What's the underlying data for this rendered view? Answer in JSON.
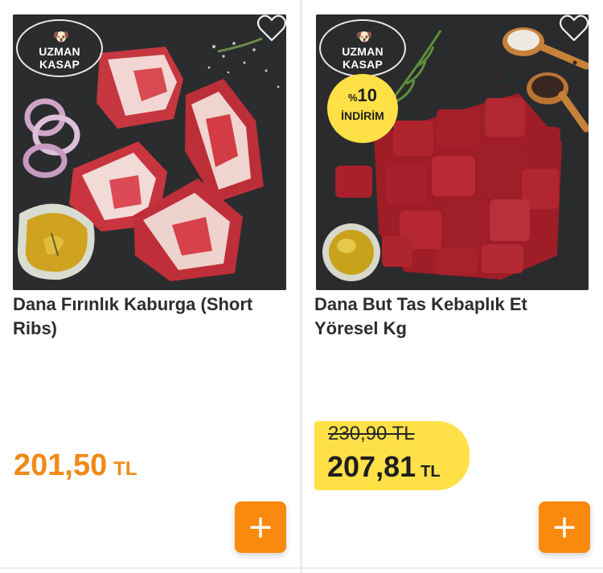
{
  "products": [
    {
      "brand": "UZMAN KASAP",
      "name": "Dana Fırınlık Kaburga (Short Ribs)",
      "price": "201,50",
      "currency": "TL",
      "favorite_icon": "heart-outline-icon",
      "add_icon": "plus-icon"
    },
    {
      "brand": "UZMAN KASAP",
      "name": "Dana But Tas Kebaplık Et Yöresel Kg",
      "discount_percent_symbol": "%",
      "discount_value": "10",
      "discount_label": "İNDİRİM",
      "old_price": "230,90 TL",
      "price": "207,81",
      "currency": "TL",
      "favorite_icon": "heart-outline-icon",
      "add_icon": "plus-icon"
    }
  ],
  "colors": {
    "accent_orange": "#f98a0e",
    "price_orange": "#f08a15",
    "discount_yellow": "#ffe047",
    "title_text": "#2d2d2d",
    "divider": "#ececec"
  }
}
